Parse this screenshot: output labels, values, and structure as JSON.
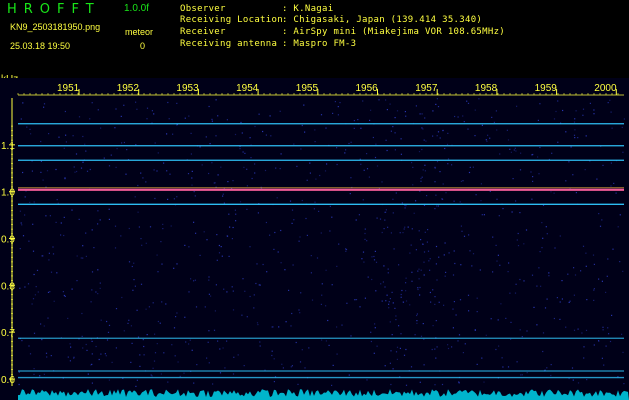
{
  "app": {
    "logo": "HROFFT",
    "version": "1.0.0f",
    "filename": "KN9_2503181950.png",
    "meteor_label": "meteor",
    "meteor_count": "0",
    "timestamp": "25.03.18 19:50"
  },
  "info": [
    {
      "label": "Observer",
      "value": ": K.Nagai"
    },
    {
      "label": "Receiving Location",
      "value": ": Chigasaki, Japan (139.414 35.340)"
    },
    {
      "label": "Receiver",
      "value": ": AirSpy mini (Miakejima VOR 108.65MHz)"
    },
    {
      "label": "Receiving antenna",
      "value": ": Maspro FM-3"
    }
  ],
  "spectrogram": {
    "unit_label": "kHz",
    "time_ticks": [
      "1951",
      "1952",
      "1953",
      "1954",
      "1955",
      "1956",
      "1957",
      "1958",
      "1959",
      "2000"
    ],
    "freq_ticks": [
      "1.1",
      "1.0",
      "0.9",
      "0.8",
      "0.7",
      "0.6"
    ],
    "freq_range_khz": [
      0.585,
      1.2
    ],
    "time_range_min": [
      0,
      10
    ],
    "carrier_lines_khz": [
      1.145,
      1.098,
      1.067,
      1.004,
      0.973,
      0.687,
      0.617,
      0.603
    ],
    "colors": {
      "background": "#000018",
      "tick": "#ffff40",
      "carrier": "#30c8ff",
      "main_carrier": "#ff60a0",
      "noise": "#3040d0",
      "text_green": "#19e619",
      "text_yellow": "#ffff40"
    }
  }
}
